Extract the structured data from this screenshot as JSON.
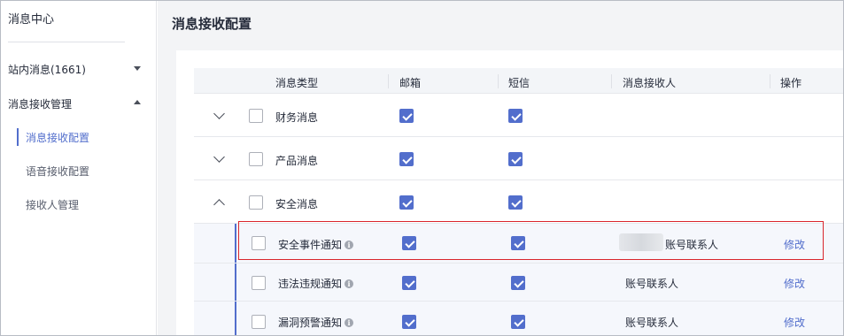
{
  "sidebar": {
    "title": "消息中心",
    "groups": [
      {
        "label": "站内消息(1661)",
        "expanded": false
      },
      {
        "label": "消息接收管理",
        "expanded": true
      }
    ],
    "items": [
      {
        "label": "消息接收配置",
        "active": true
      },
      {
        "label": "语音接收配置",
        "active": false
      },
      {
        "label": "接收人管理",
        "active": false
      }
    ]
  },
  "main": {
    "title": "消息接收配置"
  },
  "table": {
    "headers": {
      "type": "消息类型",
      "email": "邮箱",
      "sms": "短信",
      "recipient": "消息接收人",
      "action": "操作"
    },
    "rows": [
      {
        "name": "财务消息",
        "expanded": false,
        "selected": false,
        "email": true,
        "sms": true
      },
      {
        "name": "产品消息",
        "expanded": false,
        "selected": false,
        "email": true,
        "sms": true
      },
      {
        "name": "安全消息",
        "expanded": true,
        "selected": false,
        "email": true,
        "sms": true
      }
    ],
    "subrows": [
      {
        "name": "安全事件通知",
        "selected": false,
        "email": true,
        "sms": true,
        "recipient": "账号联系人",
        "action": "修改",
        "highlighted": true
      },
      {
        "name": "违法违规通知",
        "selected": false,
        "email": true,
        "sms": true,
        "recipient": "账号联系人",
        "action": "修改",
        "highlighted": false
      },
      {
        "name": "漏洞预警通知",
        "selected": false,
        "email": true,
        "sms": true,
        "recipient": "账号联系人",
        "action": "修改",
        "highlighted": false
      }
    ]
  },
  "colors": {
    "accent": "#526ecc",
    "highlight_border": "#d9262c"
  }
}
